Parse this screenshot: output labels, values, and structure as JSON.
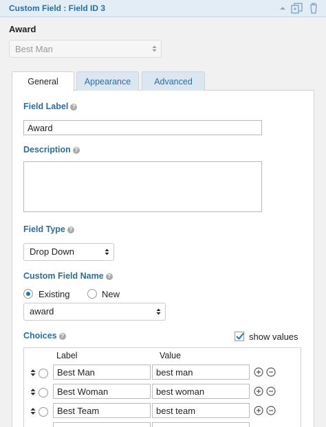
{
  "titlebar": {
    "title": "Custom Field : Field ID 3",
    "icons": [
      "collapse-arrow-icon",
      "duplicate-icon",
      "delete-icon"
    ]
  },
  "preview": {
    "label": "Award",
    "select_value": "Best Man"
  },
  "tabs": [
    {
      "label": "General",
      "active": true
    },
    {
      "label": "Appearance",
      "active": false
    },
    {
      "label": "Advanced",
      "active": false
    }
  ],
  "general": {
    "field_label": {
      "label": "Field Label",
      "value": "Award"
    },
    "description": {
      "label": "Description",
      "value": ""
    },
    "field_type": {
      "label": "Field Type",
      "value": "Drop Down"
    },
    "custom_field_name": {
      "label": "Custom Field Name",
      "options": [
        {
          "label": "Existing",
          "checked": true
        },
        {
          "label": "New",
          "checked": false
        }
      ],
      "select_value": "award"
    },
    "choices": {
      "label": "Choices",
      "show_values_label": "show values",
      "show_values_checked": true,
      "headers": {
        "label": "Label",
        "value": "Value"
      },
      "rows": [
        {
          "label": "Best Man",
          "value": "best man"
        },
        {
          "label": "Best Woman",
          "value": "best woman"
        },
        {
          "label": "Best Team",
          "value": "best team"
        },
        {
          "label": "",
          "value": ""
        }
      ]
    }
  },
  "colors": {
    "accent": "#2c6d9f",
    "titlebar_bg": "#e3edf6",
    "checkbox_check": "#2271b1"
  }
}
